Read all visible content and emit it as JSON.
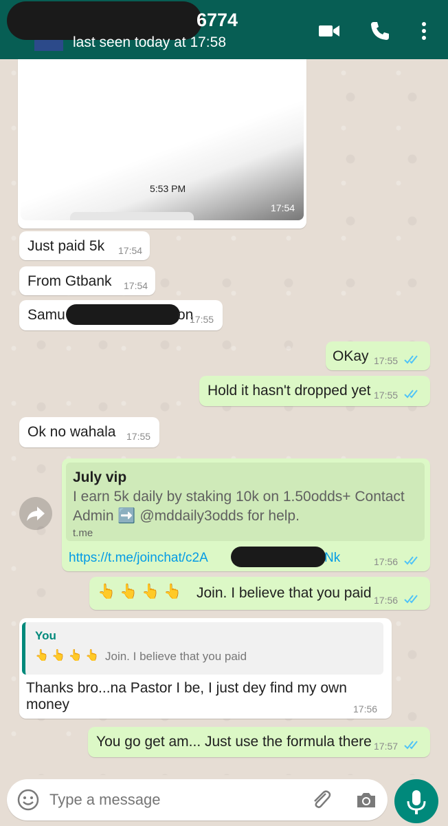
{
  "header": {
    "title_fragment": "6774",
    "status": "last seen today at 17:58",
    "icons": [
      "video-call-icon",
      "voice-call-icon",
      "more-options-icon"
    ]
  },
  "messages": {
    "image_msg": {
      "inner_time": "5:53 PM",
      "time": "17:54"
    },
    "m1": {
      "text": "Just paid 5k",
      "time": "17:54"
    },
    "m2": {
      "text": "From Gtbank",
      "time": "17:54"
    },
    "m3": {
      "text_start": "Samu",
      "text_end": "on",
      "time": "17:55"
    },
    "m4": {
      "text": "OKay",
      "time": "17:55"
    },
    "m5": {
      "text": "Hold it hasn't dropped yet",
      "time": "17:55"
    },
    "m6": {
      "text": "Ok no wahala",
      "time": "17:55"
    },
    "link_msg": {
      "preview_title": "July vip",
      "preview_desc_1": "I earn 5k daily by staking 10k on 1.50odds+ Contact",
      "preview_desc_2": "Admin ➡️ @mddaily3odds for help.",
      "preview_domain": "t.me",
      "url_start": "https://t.me/joinchat/c2A",
      "url_end": "Nk",
      "time": "17:56"
    },
    "m8": {
      "emoji": "👆 👆 👆 👆",
      "text": "Join. I believe that you paid",
      "time": "17:56"
    },
    "m9": {
      "quote_author": "You",
      "quote_emoji": "👆 👆 👆 👆",
      "quote_text": "Join. I believe that you paid",
      "line1": "Thanks bro...na Pastor I be, I just dey find my own",
      "line2": "money",
      "time": "17:56"
    },
    "m10": {
      "text": "You go get am... Just use the formula there",
      "time": "17:57"
    }
  },
  "input": {
    "placeholder": "Type a message"
  },
  "colors": {
    "header": "#075e54",
    "outgoing": "#dcf8c6",
    "incoming": "#ffffff",
    "read_ticks": "#4fc3f7",
    "link": "#039be5",
    "quote_accent": "#00897b",
    "mic": "#00897b"
  }
}
